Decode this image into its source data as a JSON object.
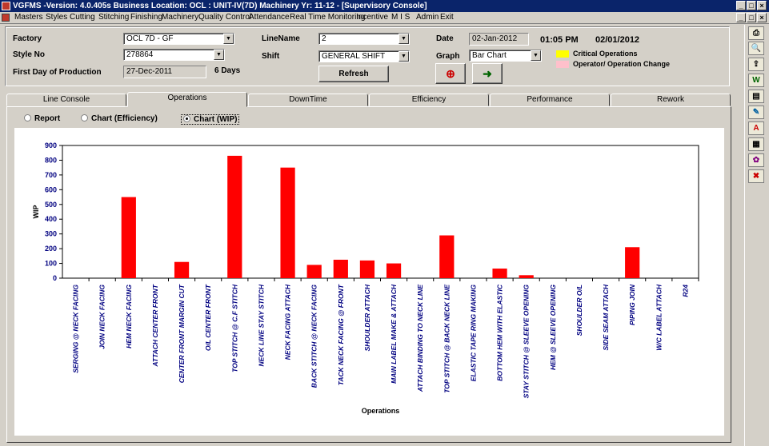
{
  "window": {
    "title": "VGFMS -Version: 4.0.405s Business Location: OCL : UNIT-IV(7D)  Machinery Yr: 11-12  - [Supervisory Console]"
  },
  "menu": [
    "Masters",
    "Styles",
    "Cutting",
    "Stitching",
    "Finishing",
    "Machinery",
    "Quality Control",
    "Attendance",
    "Real Time Monitoring",
    "Incentive",
    "M I S",
    "Admin",
    "Exit"
  ],
  "form": {
    "factory_label": "Factory",
    "factory_value": "OCL 7D - GF",
    "style_label": "Style No",
    "style_value": "278864",
    "first_day_label": "First Day of Production",
    "first_day_value": "27-Dec-2011",
    "days": "6 Days",
    "linename_label": "LineName",
    "linename_value": "2",
    "shift_label": "Shift",
    "shift_value": "GENERAL SHIFT",
    "refresh_label": "Refresh",
    "date_label": "Date",
    "date_value": "02-Jan-2012",
    "time": "01:05 PM",
    "date_display": "02/01/2012",
    "graph_label": "Graph",
    "graph_value": "Bar Chart",
    "legend_critical": "Critical Operations",
    "legend_change": "Operator/ Operation Change"
  },
  "colors": {
    "critical": "#ffff00",
    "change": "#ffc0cb",
    "bar": "#ff0000",
    "titlebar": "#0a246a"
  },
  "tabs": [
    "Line Console",
    "Operations",
    "DownTime",
    "Efficiency",
    "Performance",
    "Rework"
  ],
  "active_tab": "Operations",
  "view_options": [
    "Report",
    "Chart (Efficiency)",
    "Chart (WIP)"
  ],
  "selected_view": "Chart (WIP)",
  "chart_data": {
    "type": "bar",
    "xlabel": "Operations",
    "ylabel": "WIP",
    "ylim": [
      0,
      900
    ],
    "yticks": [
      0,
      100,
      200,
      300,
      400,
      500,
      600,
      700,
      800,
      900
    ],
    "grid": false,
    "categories": [
      "SERGING @ NECK FACING",
      "JOIN NECK FACING",
      "HEM NECK FACING",
      "ATTACH CENTER FRONT",
      "CENTER FRONT MARGIN CUT",
      "O/L CENTER FRONT",
      "TOP STITCH @ C.F STITCH",
      "NECK LINE STAY STITCH",
      "NECK FACING ATTACH",
      "BACK STITCH @ NECK FACING",
      "TACK NECK FACING @ FRONT",
      "SHOULDER ATTACH",
      "MAIN LABEL MAKE & ATTACH",
      "ATTACH BINDING TO NECK LINE",
      "TOP STITCH @ BACK NECK LINE",
      "ELASTIC TAPE RING MAKING",
      "BOTTOM HEM WITH ELASTIC",
      "STAY STITCH @ SLEEVE OPENING",
      "HEM @ SLEEVE OPENING",
      "SHOULDER O/L",
      "SIDE SEAM ATTACH",
      "PIPING JOIN",
      "W/C LABEL ATTACH",
      "R24"
    ],
    "values": [
      0,
      0,
      550,
      0,
      110,
      0,
      830,
      0,
      750,
      90,
      125,
      120,
      100,
      0,
      290,
      0,
      65,
      20,
      0,
      0,
      0,
      210,
      0,
      0
    ]
  },
  "toolbar_icons": [
    "printer-icon",
    "preview-icon",
    "export-icon",
    "word-icon",
    "document-icon",
    "notepad-icon",
    "pdf-icon",
    "grid-icon",
    "palette-icon",
    "exit-icon"
  ]
}
